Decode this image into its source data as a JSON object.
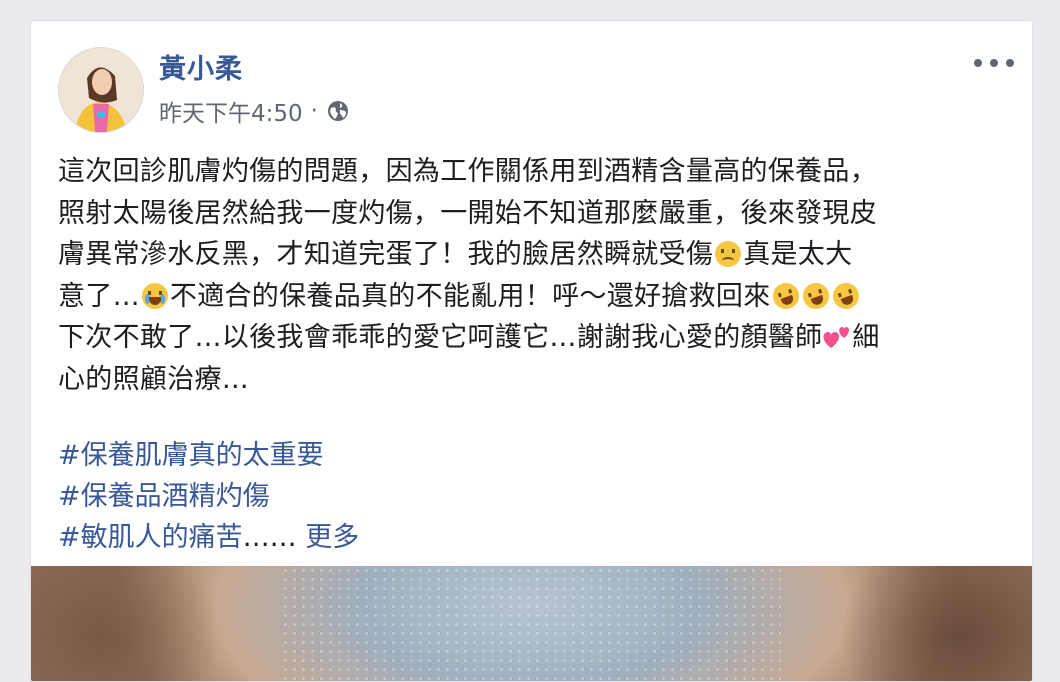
{
  "post": {
    "author": "黃小柔",
    "timestamp": "昨天下午4:50",
    "separator": "·",
    "privacy_icon": "globe-icon",
    "options_icon": "more-icon",
    "body_lines": [
      [
        "這次回診肌膚灼傷的問題，因為工作關係用到酒精含量高的保養品，"
      ],
      [
        "照射太陽後居然給我一度灼傷，一開始不知道那麼嚴重，後來發現皮"
      ],
      [
        "膚異常滲水反黑，才知道完蛋了！我的臉居然瞬就受傷",
        "真是太大"
      ],
      [
        "意了…",
        "不適合的保養品真的不能亂用！呼～還好搶救回來"
      ],
      [
        "下次不敢了…以後我會乖乖的愛它呵護它…謝謝我心愛的顏醫師",
        "細"
      ],
      [
        "心的照顧治療…"
      ]
    ],
    "emoji_icons": [
      "frowning-face-icon",
      "crying-face-icon",
      "rolling-laughing-icon",
      "two-hearts-icon"
    ],
    "hashtags": [
      "#保養肌膚真的太重要",
      "#保養品酒精灼傷",
      "#敏肌人的痛苦"
    ],
    "truncation": "……",
    "see_more": "更多"
  },
  "colors": {
    "link": "#385898",
    "text": "#1c1e21",
    "meta": "#616770",
    "background": "#e9ebee"
  }
}
